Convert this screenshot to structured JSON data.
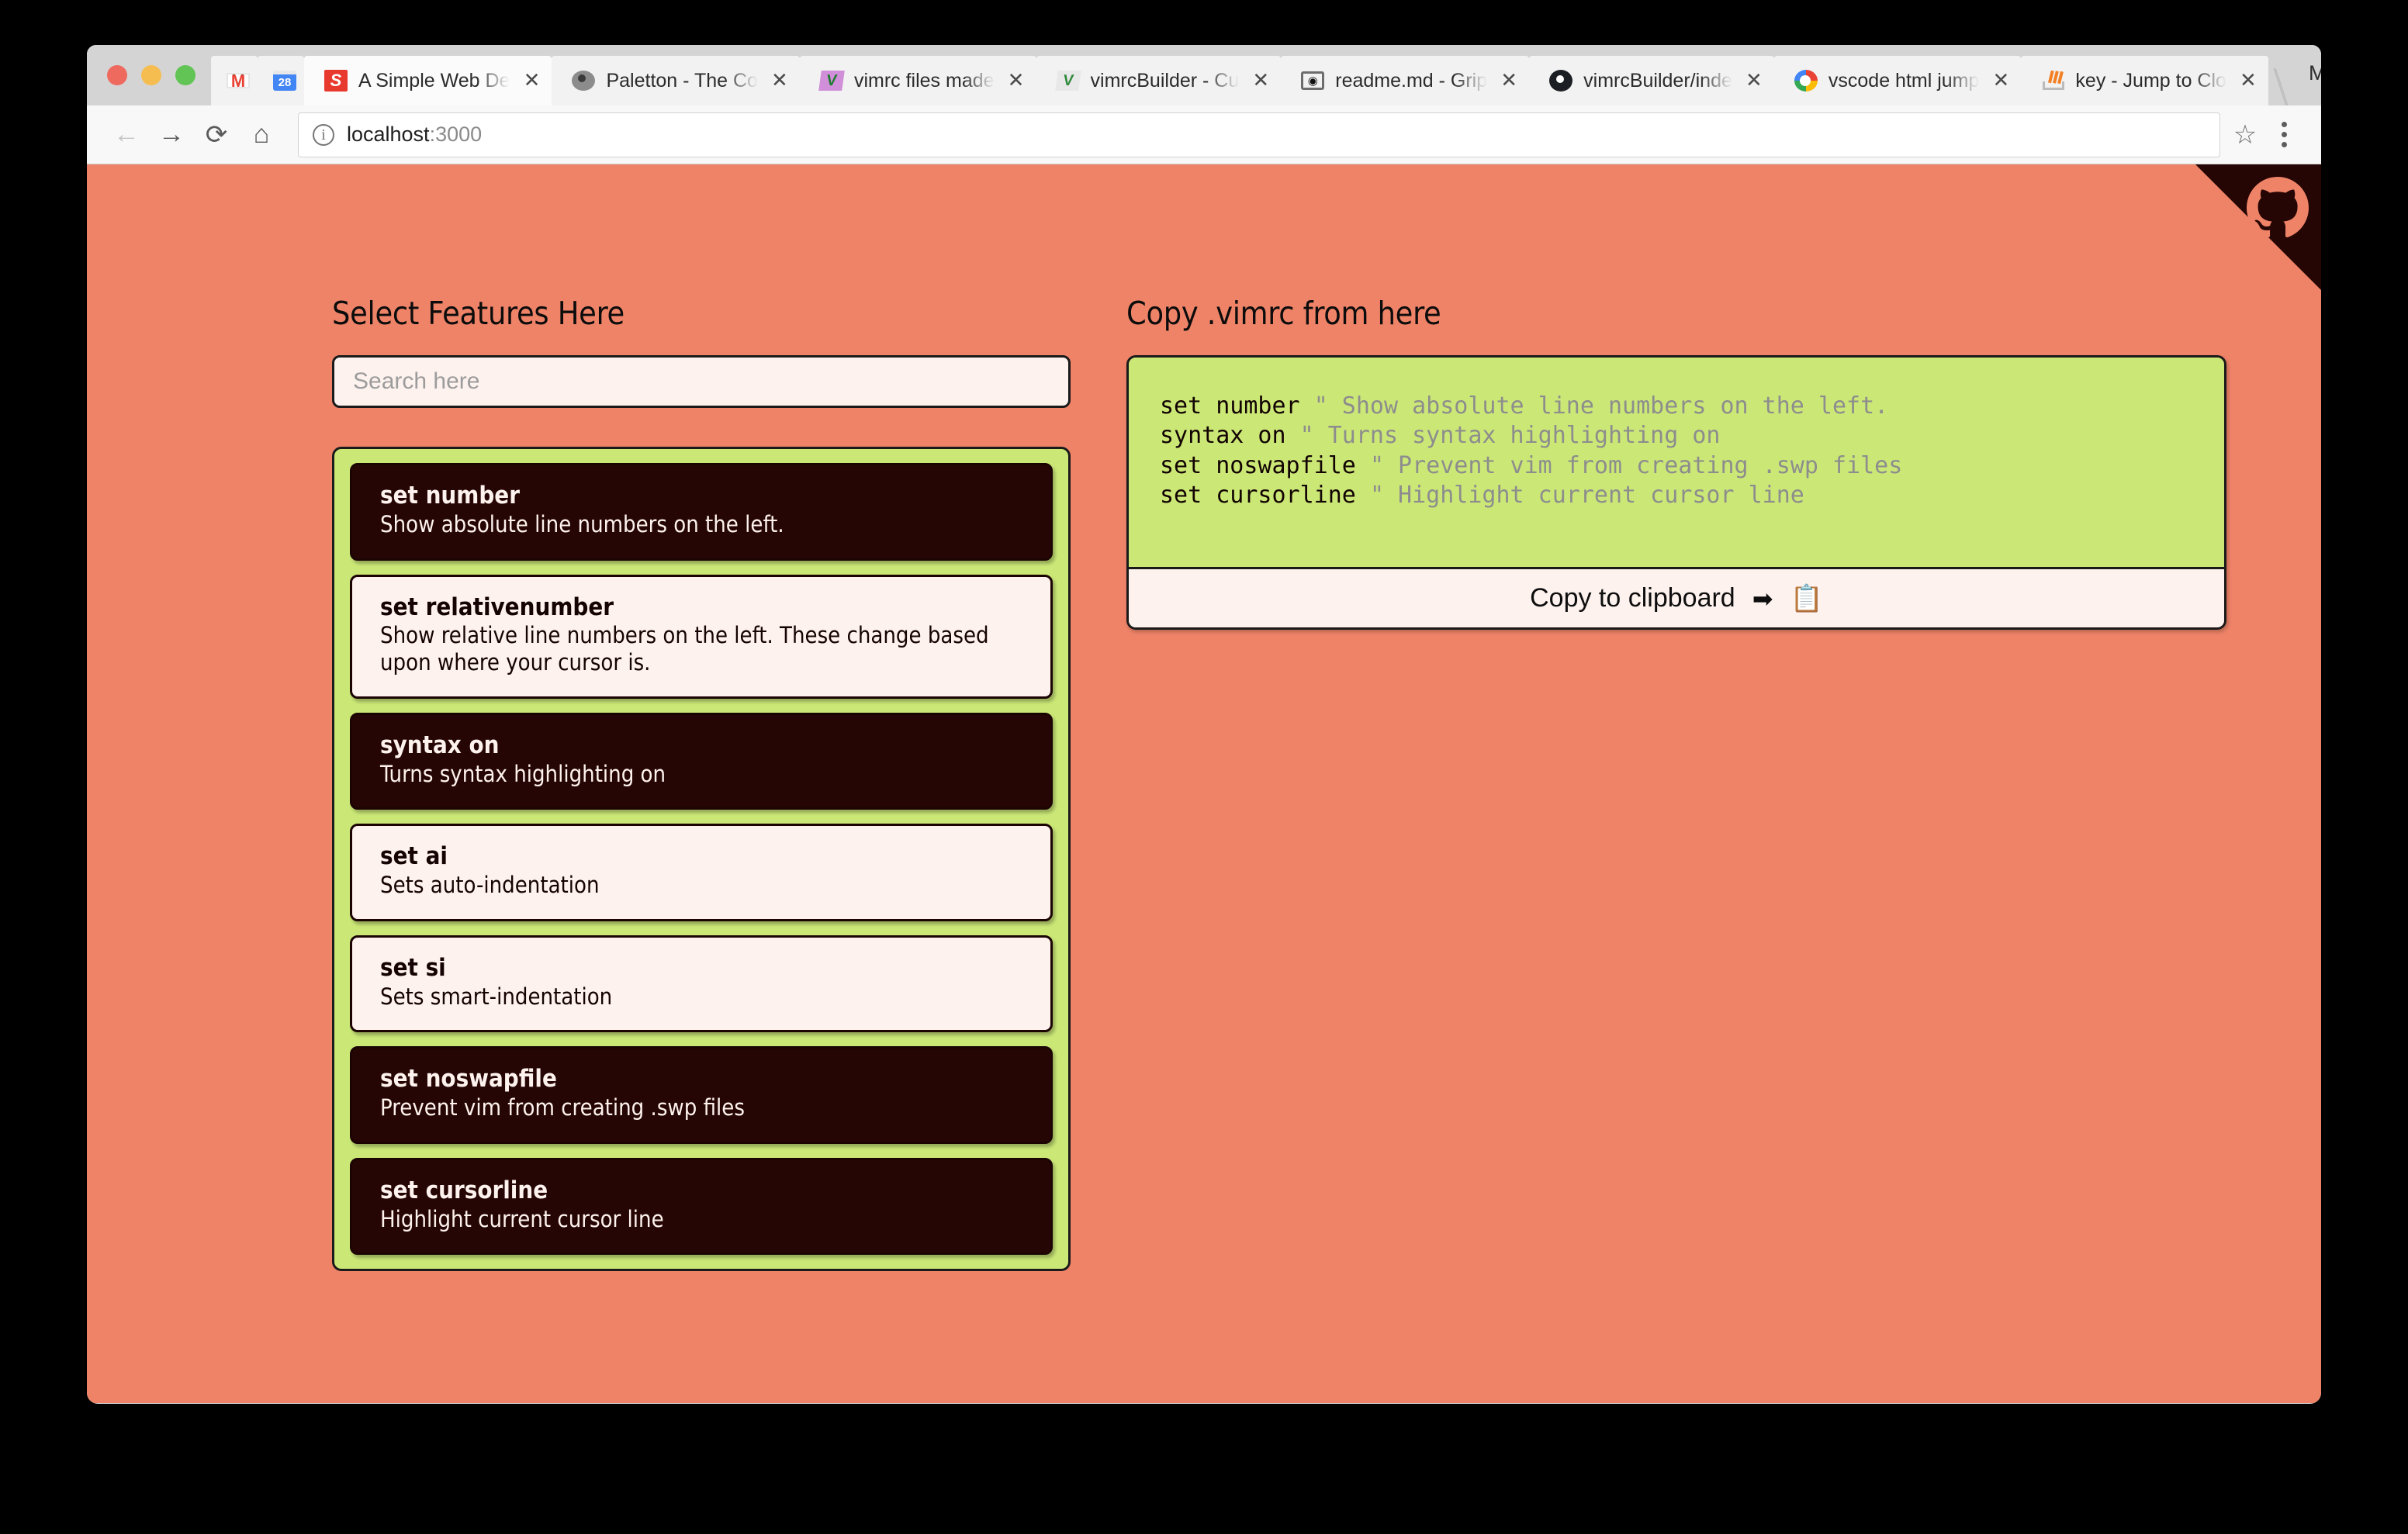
{
  "browser": {
    "profile_name": "Main",
    "tabs": [
      {
        "title": "",
        "icon": "gmail-icon",
        "icon_text": "M",
        "close": "✕",
        "active": false,
        "narrow": true
      },
      {
        "title": "",
        "icon": "calendar-icon",
        "icon_text": "28",
        "close": "✕",
        "active": false,
        "narrow": true
      },
      {
        "title": "A Simple Web De",
        "icon": "sitepoint-icon",
        "icon_text": "S",
        "close": "✕",
        "active": true,
        "narrow": false
      },
      {
        "title": "Paletton - The Co",
        "icon": "paletton-icon",
        "icon_text": "",
        "close": "✕",
        "active": false,
        "narrow": false
      },
      {
        "title": "vimrc files made",
        "icon": "vim-icon",
        "icon_text": "V",
        "close": "✕",
        "active": false,
        "narrow": false
      },
      {
        "title": "vimrcBuilder - Cu",
        "icon": "vim-alt-icon",
        "icon_text": "V",
        "close": "✕",
        "active": false,
        "narrow": false
      },
      {
        "title": "readme.md - Grip",
        "icon": "grip-icon",
        "icon_text": "◉",
        "close": "✕",
        "active": false,
        "narrow": false
      },
      {
        "title": "vimrcBuilder/inde",
        "icon": "github-icon",
        "icon_text": "",
        "close": "✕",
        "active": false,
        "narrow": false
      },
      {
        "title": "vscode html jump",
        "icon": "google-icon",
        "icon_text": "",
        "close": "✕",
        "active": false,
        "narrow": false
      },
      {
        "title": "key - Jump to Clo",
        "icon": "stackoverflow-icon",
        "icon_text": "",
        "close": "✕",
        "active": false,
        "narrow": false
      }
    ],
    "toolbar": {
      "back": "←",
      "forward": "→",
      "reload": "⟳",
      "home": "⌂",
      "info_icon": "i",
      "url_host": "localhost",
      "url_port": ":3000",
      "url_full": "localhost:3000",
      "bookmark": "☆"
    }
  },
  "page": {
    "background_color": "#ee8368",
    "accent_green": "#cbe877",
    "dark_color": "#260604",
    "cream_color": "#fdf2ee",
    "left": {
      "title": "Select Features Here",
      "search_placeholder": "Search here",
      "search_value": "",
      "features": [
        {
          "name": "set number",
          "desc": "Show absolute line numbers on the left.",
          "selected": true
        },
        {
          "name": "set relativenumber",
          "desc": "Show relative line numbers on the left. These change based upon where your cursor is.",
          "selected": false
        },
        {
          "name": "syntax on",
          "desc": "Turns syntax highlighting on",
          "selected": true
        },
        {
          "name": "set ai",
          "desc": "Sets auto-indentation",
          "selected": false
        },
        {
          "name": "set si",
          "desc": "Sets smart-indentation",
          "selected": false
        },
        {
          "name": "set noswapfile",
          "desc": "Prevent vim from creating .swp files",
          "selected": true
        },
        {
          "name": "set cursorline",
          "desc": "Highlight current cursor line",
          "selected": true
        }
      ]
    },
    "right": {
      "title": "Copy .vimrc from here",
      "code_lines": [
        {
          "cmd": "set number",
          "comment": "\" Show absolute line numbers on the left."
        },
        {
          "cmd": "syntax on",
          "comment": "\" Turns syntax highlighting on"
        },
        {
          "cmd": "set noswapfile",
          "comment": "\" Prevent vim from creating .swp files"
        },
        {
          "cmd": "set cursorline",
          "comment": "\" Highlight current cursor line"
        }
      ],
      "copy_label": "Copy to clipboard",
      "copy_arrow": "➡",
      "copy_clipboard_icon": "📋"
    }
  }
}
